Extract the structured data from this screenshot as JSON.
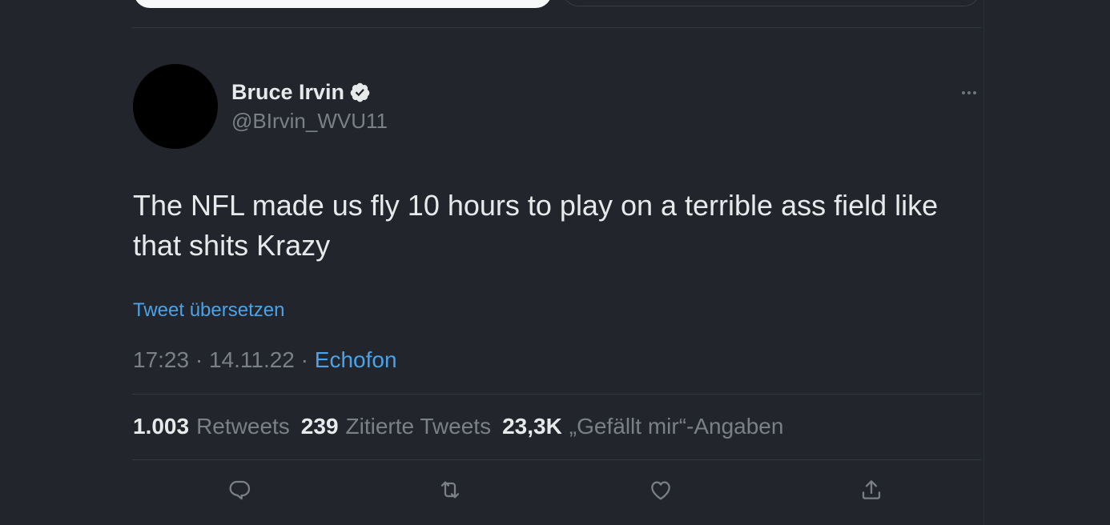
{
  "tweet": {
    "author": {
      "display_name": "Bruce Irvin",
      "handle": "@BIrvin_WVU11",
      "verified": true
    },
    "text": "The NFL made us fly 10 hours to play on a terrible ass field like that shits Krazy",
    "translate_label": "Tweet übersetzen",
    "time": "17:23",
    "date": "14.11.22",
    "separator": "·",
    "source": "Echofon",
    "stats": {
      "retweets_count": "1.003",
      "retweets_label": "Retweets",
      "quotes_count": "239",
      "quotes_label": "Zitierte Tweets",
      "likes_count": "23,3K",
      "likes_label": "„Gefällt mir“-Angaben"
    },
    "actions": [
      {
        "icon": "reply-icon"
      },
      {
        "icon": "retweet-icon"
      },
      {
        "icon": "like-icon"
      },
      {
        "icon": "share-icon"
      }
    ]
  },
  "colors": {
    "background": "#22252b",
    "text_primary": "#e7e9ea",
    "text_secondary": "#7b8087",
    "link": "#4aa3ea",
    "divider": "#343840"
  }
}
